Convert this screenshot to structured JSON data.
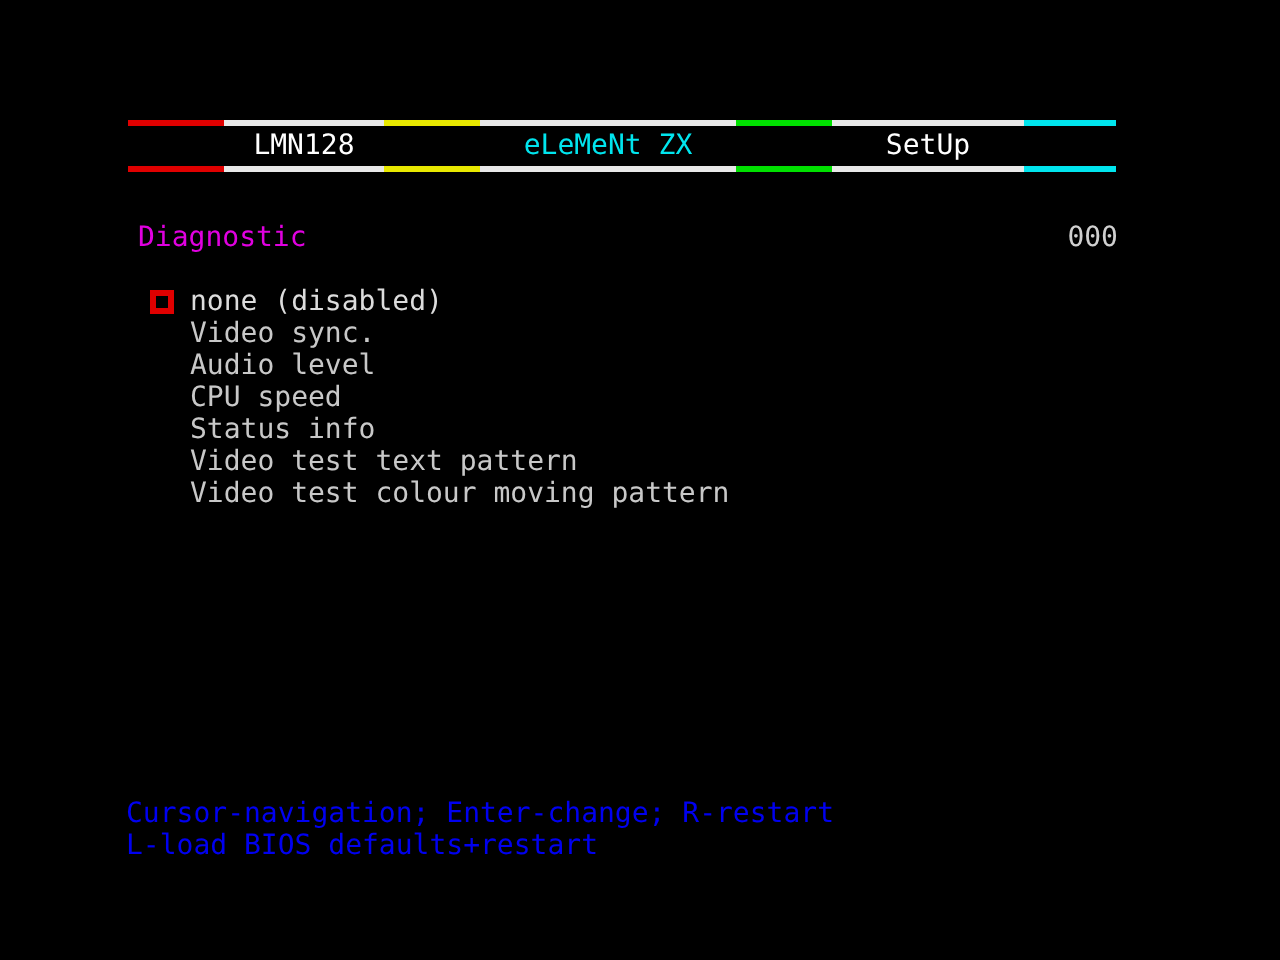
{
  "header": [
    {
      "label": "LMN128",
      "color": "#ffffff"
    },
    {
      "label": "eLeMeNt ZX",
      "color": "#00e5ee"
    },
    {
      "label": "SetUp",
      "color": "#ffffff"
    }
  ],
  "section": {
    "title": "Diagnostic",
    "value": "000"
  },
  "options": [
    {
      "label": "none (disabled)",
      "selected": true
    },
    {
      "label": "Video sync.",
      "selected": false
    },
    {
      "label": "Audio level",
      "selected": false
    },
    {
      "label": "CPU speed",
      "selected": false
    },
    {
      "label": "Status info",
      "selected": false
    },
    {
      "label": "Video test text pattern",
      "selected": false
    },
    {
      "label": "Video test colour moving pattern",
      "selected": false
    }
  ],
  "help": [
    "Cursor-navigation; Enter-change; R-restart",
    "L-load BIOS defaults+restart"
  ]
}
